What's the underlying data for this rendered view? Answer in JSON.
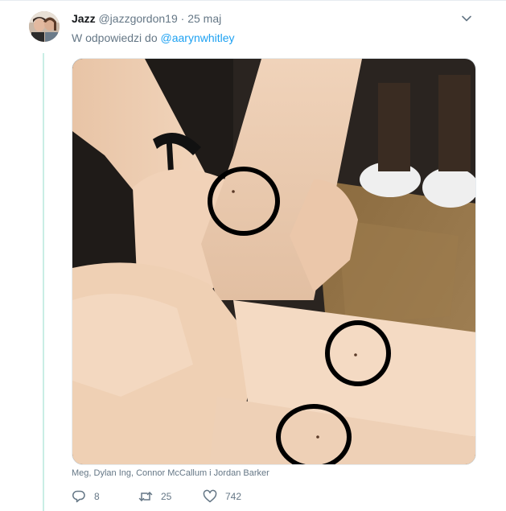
{
  "tweet": {
    "author_name": "Jazz",
    "author_handle": "@jazzgordon19",
    "separator": "·",
    "date": "25 maj",
    "reply_prefix": "W odpowiedzi do",
    "reply_handle": "@aarynwhitley",
    "photo_tags": "Meg, Dylan Ing, Connor McCallum i Jordan Barker",
    "reply_count": "8",
    "retweet_count": "25",
    "like_count": "742"
  },
  "icons": {
    "menu": "chevron-down-icon",
    "reply": "reply-icon",
    "retweet": "retweet-icon",
    "like": "heart-icon"
  },
  "colors": {
    "link": "#1da1f2",
    "muted": "#657786",
    "thread_line": "#c9eee5"
  }
}
